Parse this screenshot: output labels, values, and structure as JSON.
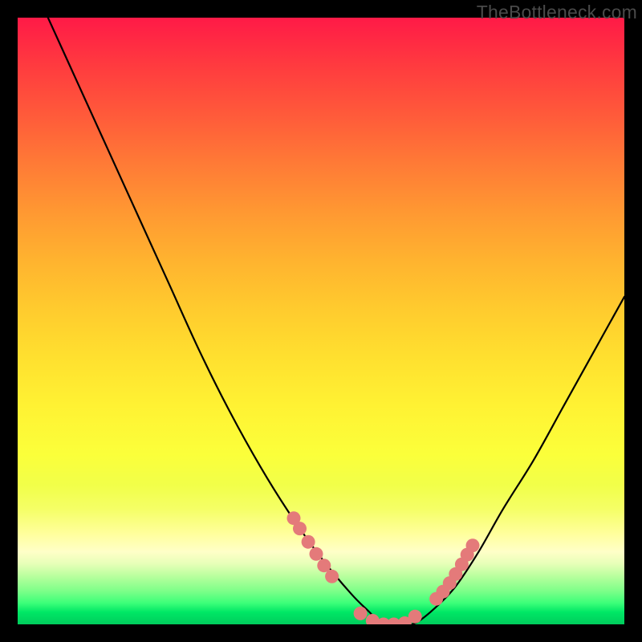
{
  "watermark": "TheBottleneck.com",
  "chart_data": {
    "type": "line",
    "title": "",
    "xlabel": "",
    "ylabel": "",
    "xlim": [
      0,
      100
    ],
    "ylim": [
      0,
      100
    ],
    "grid": false,
    "legend": false,
    "series": [
      {
        "name": "bottleneck-curve",
        "x": [
          5,
          10,
          15,
          20,
          25,
          30,
          35,
          40,
          45,
          50,
          55,
          58,
          60,
          62,
          65,
          68,
          72,
          76,
          80,
          85,
          90,
          95,
          100
        ],
        "values": [
          100,
          89,
          78,
          67,
          56,
          45,
          35,
          26,
          18,
          11,
          5,
          2,
          0,
          0,
          0,
          2,
          6,
          12,
          19,
          27,
          36,
          45,
          54
        ]
      }
    ],
    "markers": {
      "name": "highlight-dots",
      "color": "#e47a7a",
      "x": [
        45.5,
        46.5,
        47.9,
        49.2,
        50.5,
        51.8,
        56.5,
        58.5,
        60.3,
        62.0,
        63.8,
        65.5,
        69.0,
        70.1,
        71.2,
        72.2,
        73.2,
        74.1,
        75.0
      ],
      "values": [
        17.5,
        15.8,
        13.6,
        11.6,
        9.7,
        7.9,
        1.8,
        0.6,
        0.0,
        0.0,
        0.2,
        1.3,
        4.2,
        5.4,
        6.8,
        8.3,
        9.9,
        11.5,
        13.0
      ]
    },
    "background_gradient": {
      "top": "#ff1a47",
      "mid": "#fff233",
      "bottom": "#00cc5c"
    }
  }
}
